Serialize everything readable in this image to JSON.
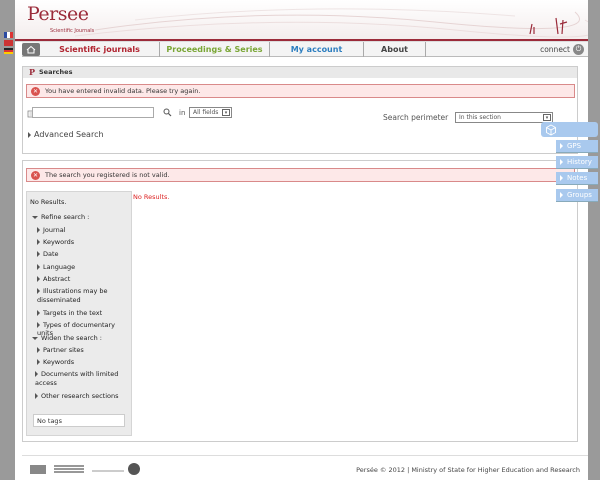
{
  "header": {
    "logo_text": "Persee",
    "logo_subtitle": "Scientific Journals"
  },
  "nav": {
    "items": [
      {
        "label": "Scientific journals",
        "color": "#b0232f"
      },
      {
        "label": "Proceedings & Series",
        "color": "#7aa635"
      },
      {
        "label": "My account",
        "color": "#2e7fc0"
      },
      {
        "label": "About",
        "color": "#444444"
      }
    ],
    "connect_label": "connect"
  },
  "searches": {
    "title": "Searches",
    "error_message": "You have entered invalid data. Please try again.",
    "search_value": "",
    "in_label": "in",
    "field_select": "All fields",
    "advanced_search": "Advanced Search",
    "perimeter_label": "Search perimeter",
    "perimeter_select": "In this section"
  },
  "results": {
    "error_message": "The search you registered is not valid.",
    "no_results_main": "No Results.",
    "sidebar": {
      "no_results": "No Results.",
      "refine_label": "Refine search :",
      "refine_items": [
        "Journal",
        "Keywords",
        "Date",
        "Language",
        "Abstract",
        "Illustrations may be disseminated",
        "Targets in the text",
        "Types of documentary units"
      ],
      "widen_label": "Widen the search :",
      "widen_items": [
        "Partner sites",
        "Keywords",
        "Documents with limited access",
        "Other research sections"
      ],
      "tags": "No tags"
    }
  },
  "tools": {
    "items": [
      "GPS",
      "History",
      "Notes",
      "Groups"
    ]
  },
  "footer": {
    "text": "Persée © 2012 | Ministry of State for Higher Education and Research"
  },
  "colors": {
    "brand": "#9b2b3a",
    "error_bg": "#fde8e8",
    "tools_blue": "#a9c9ee"
  }
}
